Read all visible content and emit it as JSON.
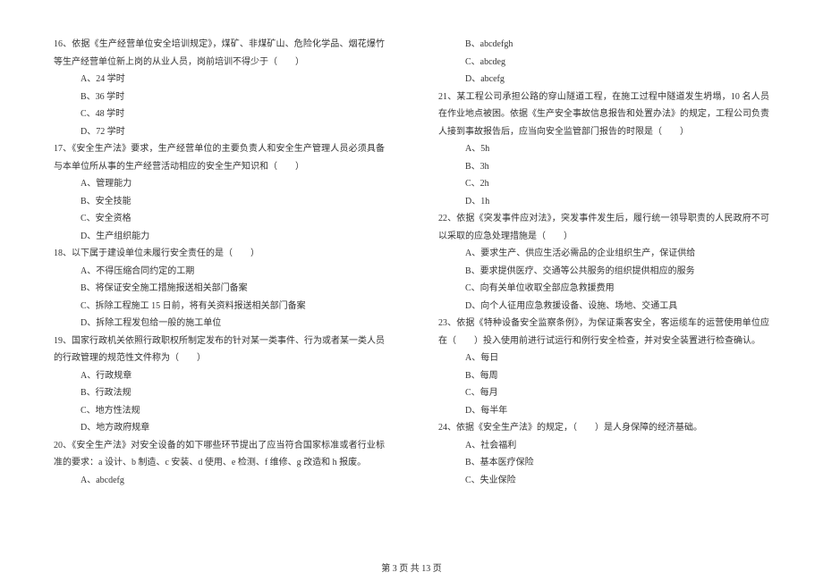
{
  "left_column": {
    "q16": {
      "text": "16、依据《生产经营单位安全培训规定》，煤矿、非煤矿山、危险化学品、烟花爆竹等生产经营单位新上岗的从业人员，岗前培训不得少于（　　）",
      "opts": [
        "A、24 学时",
        "B、36 学时",
        "C、48 学时",
        "D、72 学时"
      ]
    },
    "q17": {
      "text": "17、《安全生产法》要求，生产经营单位的主要负责人和安全生产管理人员必须具备与本单位所从事的生产经营活动相应的安全生产知识和（　　）",
      "opts": [
        "A、管理能力",
        "B、安全技能",
        "C、安全资格",
        "D、生产组织能力"
      ]
    },
    "q18": {
      "text": "18、以下属于建设单位未履行安全责任的是（　　）",
      "opts": [
        "A、不得压缩合同约定的工期",
        "B、将保证安全施工措施报送相关部门备案",
        "C、拆除工程施工 15 日前，将有关资料报送相关部门备案",
        "D、拆除工程发包给一般的施工单位"
      ]
    },
    "q19": {
      "text": "19、国家行政机关依照行政职权所制定发布的针对某一类事件、行为或者某一类人员的行政管理的规范性文件称为（　　）",
      "opts": [
        "A、行政规章",
        "B、行政法规",
        "C、地方性法规",
        "D、地方政府规章"
      ]
    },
    "q20": {
      "text": "20、《安全生产法》对安全设备的如下哪些环节提出了应当符合国家标准或者行业标准的要求：a 设计、b 制造、c 安装、d 使用、e 检测、f 维修、g 改造和 h 报废。",
      "opts": [
        "A、abcdefg"
      ]
    }
  },
  "right_column": {
    "q20_cont": {
      "opts": [
        "B、abcdefgh",
        "C、abcdeg",
        "D、abcefg"
      ]
    },
    "q21": {
      "text": "21、某工程公司承担公路的穿山隧道工程，在施工过程中隧道发生坍塌，10 名人员在作业地点被困。依据《生产安全事故信息报告和处置办法》的规定，工程公司负责人接到事故报告后，应当向安全监管部门报告的时限是（　　）",
      "opts": [
        "A、5h",
        "B、3h",
        "C、2h",
        "D、1h"
      ]
    },
    "q22": {
      "text": "22、依据《突发事件应对法》，突发事件发生后，履行统一领导职责的人民政府不可以采取的应急处理措施是（　　）",
      "opts": [
        "A、要求生产、供应生活必需品的企业组织生产，保证供给",
        "B、要求提供医疗、交通等公共服务的组织提供相应的服务",
        "C、向有关单位收取全部应急救援费用",
        "D、向个人征用应急救援设备、设施、场地、交通工具"
      ]
    },
    "q23": {
      "text": "23、依据《特种设备安全监察条例》，为保证乘客安全，客运缆车的运营使用单位应在（　　）投入使用前进行试运行和例行安全检查，并对安全装置进行检查确认。",
      "opts": [
        "A、每日",
        "B、每周",
        "C、每月",
        "D、每半年"
      ]
    },
    "q24": {
      "text": "24、依据《安全生产法》的规定，（　　）是人身保障的经济基础。",
      "opts": [
        "A、社会福利",
        "B、基本医疗保险",
        "C、失业保险"
      ]
    }
  },
  "footer": "第 3 页 共 13 页"
}
